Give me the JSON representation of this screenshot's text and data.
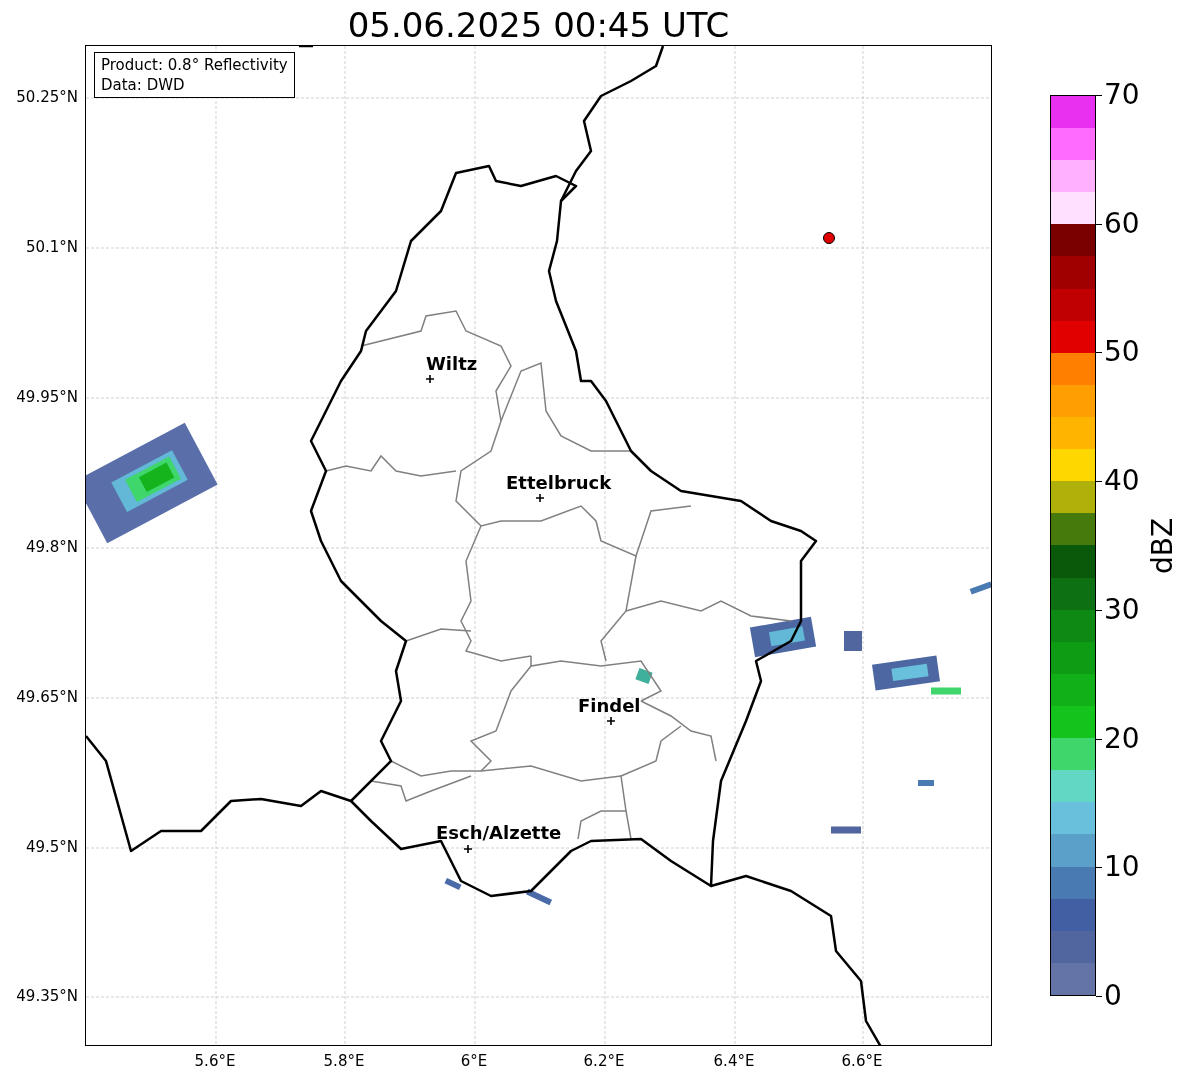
{
  "title": "05.06.2025 00:45 UTC",
  "info_box": [
    "Product: 0.8° Reflectivity",
    "Data: DWD"
  ],
  "lat_ticks": [
    "50.25°N",
    "50.1°N",
    "49.95°N",
    "49.8°N",
    "49.65°N",
    "49.5°N",
    "49.35°N"
  ],
  "lon_ticks": [
    "5.6°E",
    "5.8°E",
    "6°E",
    "6.2°E",
    "6.4°E",
    "6.6°E"
  ],
  "places": [
    {
      "name": "Wiltz"
    },
    {
      "name": "Ettelbruck"
    },
    {
      "name": "Findel"
    },
    {
      "name": "Esch/Alzette"
    }
  ],
  "colorbar": {
    "label": "dBZ",
    "ticks": [
      "70",
      "60",
      "50",
      "40",
      "30",
      "20",
      "10",
      "0"
    ],
    "bands": [
      {
        "color": "#6474a6"
      },
      {
        "color": "#51669e"
      },
      {
        "color": "#435fa3"
      },
      {
        "color": "#4a7ab2"
      },
      {
        "color": "#5aa0c8"
      },
      {
        "color": "#68c0dc"
      },
      {
        "color": "#62d8c4"
      },
      {
        "color": "#3fd66c"
      },
      {
        "color": "#14c41c"
      },
      {
        "color": "#12b018"
      },
      {
        "color": "#0f9c15"
      },
      {
        "color": "#0e8a14"
      },
      {
        "color": "#0d7012"
      },
      {
        "color": "#0a580a"
      },
      {
        "color": "#467a0c"
      },
      {
        "color": "#b0b00a"
      },
      {
        "color": "#ffd700"
      },
      {
        "color": "#ffb500"
      },
      {
        "color": "#ff9e00"
      },
      {
        "color": "#ff7f00"
      },
      {
        "color": "#e00000"
      },
      {
        "color": "#c00000"
      },
      {
        "color": "#a00000"
      },
      {
        "color": "#7a0000"
      },
      {
        "color": "#ffe0ff"
      },
      {
        "color": "#ffb0ff"
      },
      {
        "color": "#ff6aff"
      },
      {
        "color": "#e830f0"
      }
    ]
  }
}
